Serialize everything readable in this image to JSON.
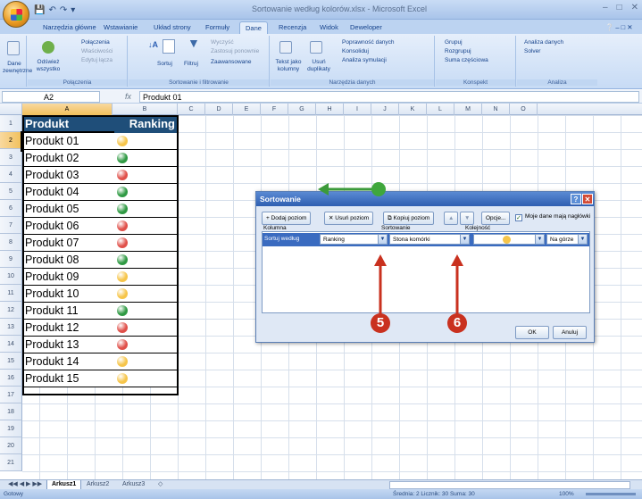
{
  "window": {
    "title": "Sortowanie według kolorów.xlsx - Microsoft Excel"
  },
  "ribbon_tabs": [
    "Narzędzia główne",
    "Wstawianie",
    "Układ strony",
    "Formuły",
    "Dane",
    "Recenzja",
    "Widok",
    "Deweloper"
  ],
  "active_tab": "Dane",
  "ribbon": {
    "dane_zewn": "Dane zewnętrzne",
    "odswiez": "Odśwież wszystko",
    "polaczenia": "Połączenia",
    "wlasciwosci": "Właściwości",
    "edytuj_laczа": "Edytuj łącza",
    "grp_polaczenia": "Połączenia",
    "sortuj": "Sortuj",
    "filtruj": "Filtruj",
    "wyczysc": "Wyczyść",
    "zastosuj": "Zastosuj ponownie",
    "zaawansowane": "Zaawansowane",
    "grp_sort": "Sortowanie i filtrowanie",
    "tekst_jako": "Tekst jako kolumny",
    "usun_dup": "Usuń duplikaty",
    "poprawnosc": "Poprawność danych",
    "konsoliduj": "Konsoliduj",
    "analiza_sym": "Analiza symulacji",
    "grp_narzedzia": "Narzędzia danych",
    "grupuj": "Grupuj",
    "rozgrupuj": "Rozgrupuj",
    "suma": "Suma częściowa",
    "grp_konspekt": "Konspekt",
    "analiza_danych": "Analiza danych",
    "solver": "Solver",
    "grp_analiza": "Analiza"
  },
  "formula_bar": {
    "name_box": "A2",
    "fx": "fx",
    "formula": "Produkt 01"
  },
  "columns": [
    "A",
    "B",
    "C",
    "D",
    "E",
    "F",
    "G",
    "H",
    "I",
    "J",
    "K",
    "L",
    "M",
    "N",
    "O"
  ],
  "rows": [
    "1",
    "2",
    "3",
    "4",
    "5",
    "6",
    "7",
    "8",
    "9",
    "10",
    "11",
    "12",
    "13",
    "14",
    "15",
    "16",
    "17",
    "18",
    "19",
    "20",
    "21"
  ],
  "table": {
    "header_a": "Produkt",
    "header_b": "Ranking",
    "rows": [
      {
        "name": "Produkt 01",
        "color": "#f6c54a"
      },
      {
        "name": "Produkt 02",
        "color": "#2f9a43"
      },
      {
        "name": "Produkt 03",
        "color": "#e0504a"
      },
      {
        "name": "Produkt 04",
        "color": "#2f9a43"
      },
      {
        "name": "Produkt 05",
        "color": "#2f9a43"
      },
      {
        "name": "Produkt 06",
        "color": "#e0504a"
      },
      {
        "name": "Produkt 07",
        "color": "#e0504a"
      },
      {
        "name": "Produkt 08",
        "color": "#2f9a43"
      },
      {
        "name": "Produkt 09",
        "color": "#f6c54a"
      },
      {
        "name": "Produkt 10",
        "color": "#f6c54a"
      },
      {
        "name": "Produkt 11",
        "color": "#2f9a43"
      },
      {
        "name": "Produkt 12",
        "color": "#e0504a"
      },
      {
        "name": "Produkt 13",
        "color": "#e0504a"
      },
      {
        "name": "Produkt 14",
        "color": "#f6c54a"
      },
      {
        "name": "Produkt 15",
        "color": "#f6c54a"
      }
    ]
  },
  "dialog": {
    "title": "Sortowanie",
    "add_level": "Dodaj poziom",
    "delete_level": "Usuń poziom",
    "copy_level": "Kopiuj poziom",
    "options": "Opcje...",
    "headers_check": "Moje dane mają nagłówki",
    "col_kolumna": "Kolumna",
    "col_sortowanie": "Sortowanie",
    "col_kolejnosc": "Kolejność",
    "row_label": "Sortuj według",
    "sort_by": "Ranking",
    "sort_on": "Stona komórki",
    "order_position": "Na górze",
    "order_color": "#f6c54a",
    "ok": "OK",
    "cancel": "Anuluj"
  },
  "markers": [
    "5",
    "6"
  ],
  "sheets": [
    "Arkusz1",
    "Arkusz2",
    "Arkusz3"
  ],
  "status": {
    "ready": "Gotowy",
    "stats": "Średnia: 2   Licznik: 30   Suma: 30",
    "zoom": "100%"
  }
}
